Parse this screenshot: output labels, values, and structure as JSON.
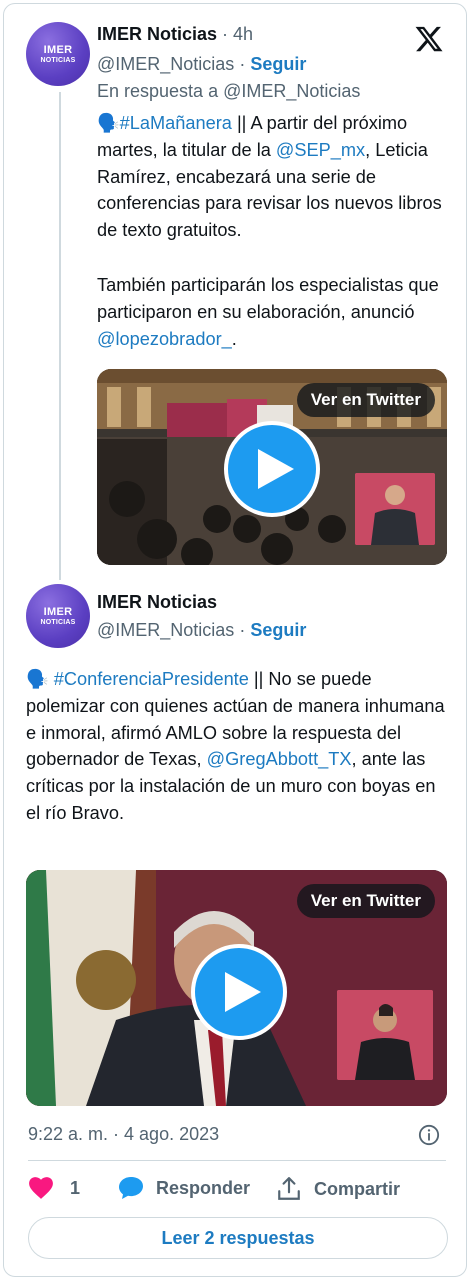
{
  "tweet1": {
    "avatar_line1": "IMER",
    "avatar_line2": "NOTICIAS",
    "name": "IMER Noticias",
    "time": "· 4h",
    "handle": "@IMER_Noticias",
    "sep": "·",
    "follow": "Seguir",
    "reply_to": "En respuesta a @IMER_Noticias",
    "emoji": "🗣️",
    "p1_hashtag": "#LaMañanera",
    "p1_a": " || A partir del próximo martes, la titular de la ",
    "p1_mention": "@SEP_mx",
    "p1_b": ", Leticia Ramírez, encabezará una serie de conferencias para revisar los nuevos libros de texto gratuitos.",
    "p2_a": "También participarán los especialistas que participaron en su elaboración, anunció ",
    "p2_mention": "@lopezobrador_",
    "p2_b": ".",
    "video_label": "Ver en Twitter"
  },
  "tweet2": {
    "avatar_line1": "IMER",
    "avatar_line2": "NOTICIAS",
    "name": "IMER Noticias",
    "handle": "@IMER_Noticias",
    "sep": "·",
    "follow": "Seguir",
    "emoji": "🗣️",
    "hashtag": "#ConferenciaPresidente",
    "text_a": " || No se puede polemizar con quienes actúan de manera inhumana e inmoral, afirmó AMLO sobre la respuesta del gobernador de Texas, ",
    "mention": "@GregAbbott_TX",
    "text_b": ", ante las críticas por la instalación de un muro con boyas en el río Bravo.",
    "video_label": "Ver en Twitter"
  },
  "footer": {
    "timestamp": "9:22 a. m. · 4 ago. 2023",
    "likes": "1",
    "reply_label": "Responder",
    "share_label": "Compartir",
    "read_replies": "Leer 2 respuestas"
  },
  "colors": {
    "link": "#1d7bc1",
    "play": "#1d9bf0",
    "like": "#f91880",
    "avatar": "#5b3fc2"
  },
  "icons": [
    "x-logo-icon",
    "play-icon",
    "heart-icon",
    "reply-icon",
    "share-icon",
    "info-icon"
  ]
}
